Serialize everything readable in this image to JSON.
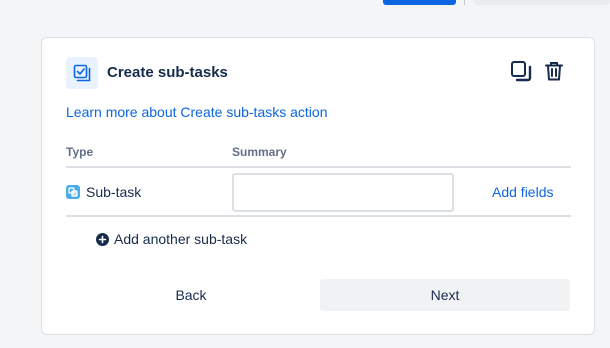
{
  "colors": {
    "primary": "#0c66e4",
    "text": "#172b4d",
    "subtle_text": "#626f86",
    "border": "#dcdfe4",
    "icon_bg": "#e9f2ff",
    "subtask_icon": "#4bade8"
  },
  "card": {
    "title": "Create sub-tasks",
    "icon": "checkbox-stack-icon",
    "learn_more": "Learn more about Create sub-tasks action",
    "copy_icon": "copy-icon",
    "delete_icon": "trash-icon"
  },
  "table": {
    "headers": {
      "type": "Type",
      "summary": "Summary"
    },
    "rows": [
      {
        "type": "Sub-task",
        "type_icon": "subtask-icon",
        "summary": "",
        "action": "Add fields"
      }
    ]
  },
  "add_another": "Add another sub-task",
  "buttons": {
    "back": "Back",
    "next": "Next"
  }
}
